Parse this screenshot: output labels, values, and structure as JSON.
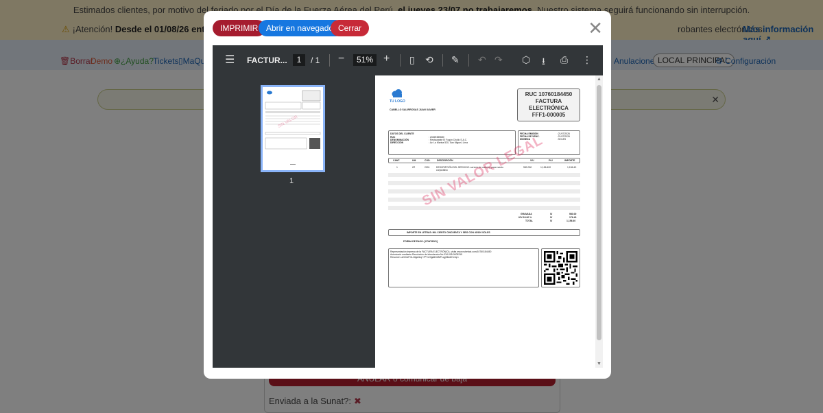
{
  "banner": {
    "line1_pre": "Estimados clientes, por motivo del feriado por el Día de la Fuerza Aérea del Perú, ",
    "line1_bold": "el jueves 23/07 no trabajaremos",
    "line1_post": ". Nuestro sistema seguirá funcionando sin interrupción.",
    "line2_warn": "¡Atención!",
    "line2_bold": "Desde el 01/08/26 entran en v",
    "line2_tail": "robantes electrónicos.",
    "line2_link": "Más información aquí"
  },
  "topnav": {
    "borrar": "Borrar",
    "demo": "Demo",
    "ayuda": "¿Ayuda?",
    "tickets": "Tickets",
    "maqui": "MaQui",
    "anulaciones": "Anulaciones",
    "local": "LOCAL PRINCIPAL",
    "configuracion": "Configuración"
  },
  "bg": {
    "card_button": "ANULAR o comunicar de baja",
    "sunat_label": "Enviada a la Sunat?:"
  },
  "modal": {
    "print_label": "IMPRIMIR",
    "open_label": "Abrir en navegador",
    "close_label": "Cerrar"
  },
  "viewer": {
    "title": "FACTUR...",
    "page_current": "1",
    "page_total": "/   1",
    "zoom": "51%",
    "thumb_page": "1"
  },
  "invoice": {
    "logo": "TU LOGO",
    "emisor": "CABELLO SALIRROSAS JUAN XAVIER",
    "ruc_line": "RUC 10760184450",
    "doc_type_1": "FACTURA",
    "doc_type_2": "ELECTRÓNICA",
    "serie": "FFF1-000005",
    "cliente_header": "DATOS DEL CLIENTE",
    "cliente": [
      {
        "k": "RUC",
        "v": ": 20469385680"
      },
      {
        "k": "DENOMINACIÓN",
        "v": ": Restaurante El Fogón Criollo S.A.C."
      },
      {
        "k": "DIRECCIÓN",
        "v": ": Av. La Marina 520, San Miguel, Lima"
      }
    ],
    "fechas": [
      {
        "k": "FECHA EMISIÓN",
        "v": ": 21/07/2026"
      },
      {
        "k": "FECHA DE VENC.",
        "v": ": 21/07/2026"
      },
      {
        "k": "MONEDA",
        "v": ": SOLES"
      }
    ],
    "columns": [
      "CANT.",
      "UM",
      "COD.",
      "DESCRIPCIÓN",
      "V/U",
      "P/U",
      "IMPORTE"
    ],
    "item": {
      "cant": "1",
      "um": "ZZ",
      "cod": "2001",
      "desc": "DESCRIPCIÓN DEL SERVICIO: servicio de catering para evento corporativo",
      "vu": "980.000",
      "pu": "1,156.400",
      "importe": "1,156.40"
    },
    "watermark": "SIN VALOR LEGAL",
    "totals": [
      {
        "k": "GRAVADA",
        "c": "S/",
        "v": "980.00"
      },
      {
        "k": "IGV 18.00 %",
        "c": "S/",
        "v": "176.40"
      },
      {
        "k": "TOTAL",
        "c": "S/",
        "v": "1,156.40"
      }
    ],
    "letras": "IMPORTE EN LETRAS:  MIL CIENTO CINCUENTA Y SEIS CON 40/100 SOLES",
    "forma_pago": "FORMA DE PAGO: [CONTADO]",
    "rep_1": "Representación impresa de la FACTURA ELECTRÓNICA, visita www.nubefact.com/10760184450",
    "rep_2": "Autorizado mediante Resolución de Intendencia No.034-005-0005315",
    "rep_3": "Resumen: aG0rUFGL/4tgdnhq+7PTxOfgd6GbMPLqg94dd07vJq/=",
    "sin_valor": "SIN VALOR LEGAL"
  },
  "colors": {
    "print_btn": "#a51c2f",
    "open_btn": "#1677e0",
    "close_btn": "#c72a38",
    "banner_bg": "#fff1c7",
    "viewer_bg": "#323639"
  }
}
